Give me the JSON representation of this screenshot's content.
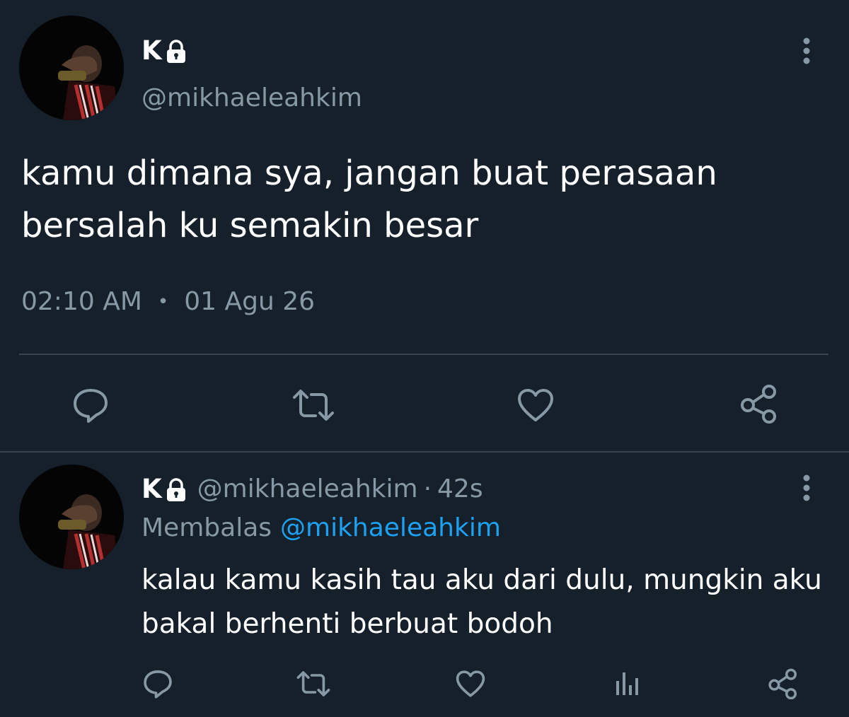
{
  "main_tweet": {
    "display_name": "K",
    "handle": "@mikhaeleahkim",
    "text": "kamu dimana sya, jangan buat perasaan\nbersalah ku semakin besar",
    "time": "02:10 AM",
    "separator": "•",
    "date": "01 Agu 26",
    "actions": [
      "reply-icon",
      "retweet-icon",
      "like-icon",
      "share-icon"
    ]
  },
  "reply_tweet": {
    "display_name": "K",
    "handle": "@mikhaeleahkim",
    "meta_separator": "·",
    "age": "42s",
    "replying_label": "Membalas",
    "replying_to": "@mikhaeleahkim",
    "text": "kalau kamu kasih tau aku dari dulu, mungkin aku\nbakal berhenti berbuat bodoh",
    "actions": [
      "reply-icon",
      "retweet-icon",
      "like-icon",
      "analytics-icon",
      "share-icon"
    ]
  },
  "colors": {
    "background": "#15202b",
    "text": "#ffffff",
    "muted": "#8899a6",
    "link": "#1da1f2",
    "divider": "#38444d"
  }
}
